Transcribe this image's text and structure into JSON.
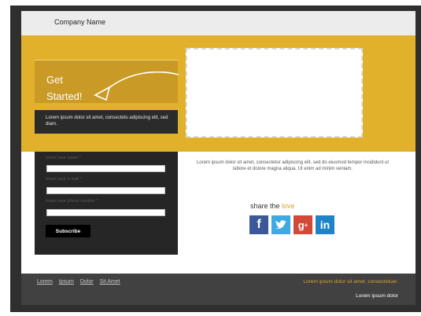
{
  "header": {
    "company_name": "Company Name"
  },
  "hero": {
    "get_started_line1": "Get",
    "get_started_line2": "Started!",
    "description": "Lorem ipsum dolor sit amet, consectetu adipiscing elit, sed diam."
  },
  "form": {
    "name_label": "Insert your name *",
    "email_label": "Insert your e-mail *",
    "phone_label": "Insert your phone number *",
    "subscribe_label": "Subscribe"
  },
  "content": {
    "body_text": "Lorem ipsum dolor sit amet, consectetur adipiscing elit, sed do eiusmod tempor incididunt ut labore et dolore magna aliqua. Ut enim ad minim veniam.",
    "share_prefix": "share the",
    "share_highlight": "love",
    "social_icons": [
      "facebook-icon",
      "twitter-icon",
      "google-plus-icon",
      "linkedin-icon"
    ]
  },
  "footer": {
    "links": [
      "Lorem",
      "Ipsum",
      "Dolor",
      "Sit Amet"
    ],
    "right_line1": "Lorem ipsum dolor sit amet, consectetuer.",
    "right_line2": "Lorem ipsum dolor"
  },
  "colors": {
    "accent": "#e2b12b",
    "dark": "#262626",
    "footer": "#414141"
  }
}
